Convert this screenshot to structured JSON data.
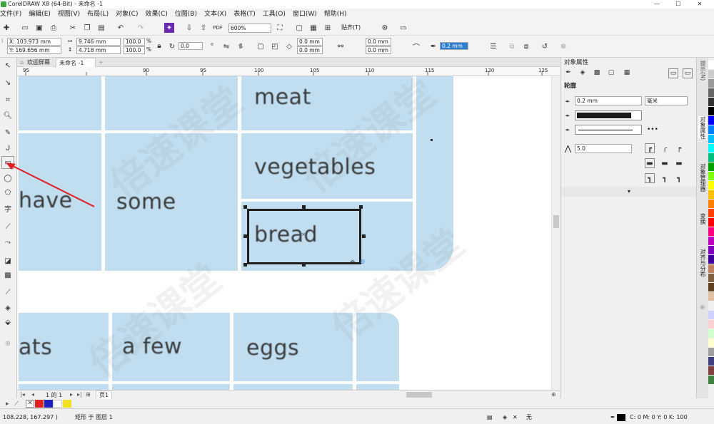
{
  "window": {
    "title": "CorelDRAW X8 (64-Bit) - 未命名 -1",
    "controls": [
      "—",
      "☐",
      "✕"
    ]
  },
  "menu": [
    "文件(F)",
    "编辑(E)",
    "视图(V)",
    "布局(L)",
    "对象(C)",
    "效果(C)",
    "位图(B)",
    "文本(X)",
    "表格(T)",
    "工具(O)",
    "窗口(W)",
    "帮助(H)"
  ],
  "standard": {
    "zoom": "600%",
    "snap": "贴齐(T)"
  },
  "props": {
    "x": "X: 103.973 mm",
    "y": "Y: 169.656 mm",
    "w": "9.746 mm",
    "h": "4.718 mm",
    "sx": "100.0",
    "sy": "100.0",
    "pct": "%",
    "rotation": "0.0",
    "corner1": "0.0 mm",
    "corner2": "0.0 mm",
    "corner3": "0.0 mm",
    "corner4": "0.0 mm",
    "outline": "0.2 mm"
  },
  "tabs": {
    "welcome": "欢迎屏幕",
    "doc": "未命名 -1"
  },
  "ruler": [
    "95",
    "90",
    "95",
    "100",
    "105",
    "110",
    "115",
    "120",
    "125"
  ],
  "canvas": {
    "words": [
      "meat",
      "vegetables",
      "have",
      "some",
      "bread",
      "ats",
      "a few",
      "eggs"
    ],
    "watermark": "倍速课堂"
  },
  "pagebar": {
    "pageinfo": "1 的 1",
    "page": "页1"
  },
  "status": {
    "coords": "108.228, 167.297 )",
    "object": "矩形 于 图层 1",
    "fill": "无",
    "outline": "C: 0 M: 0 Y: 0 K: 100"
  },
  "docker": {
    "title": "对象属性",
    "section": "轮廓",
    "width": "0.2 mm",
    "unit": "毫米",
    "dash": "•••",
    "miter": "5.0",
    "more": "▾"
  },
  "vtabs": [
    "提示(N)",
    "对象属性",
    "对象管理器",
    "变换",
    "对齐与分布"
  ],
  "colors": {
    "accent": "#2f7fd5",
    "cell": "#c0def0",
    "arrow": "#e02020",
    "palette": [
      "#ffffff",
      "#000000",
      "#e02020",
      "#2020c0",
      "#ffffff",
      "#f0e020"
    ],
    "rightpal": [
      "#ffffff",
      "#cccccc",
      "#999999",
      "#666666",
      "#333333",
      "#000000",
      "#0000ff",
      "#0080ff",
      "#00c0ff",
      "#00ffff",
      "#00c080",
      "#00a000",
      "#80ff00",
      "#ffff00",
      "#ffc000",
      "#ff8000",
      "#ff4000",
      "#ff0000",
      "#ff0080",
      "#c000c0",
      "#8000c0",
      "#4000a0",
      "#c08060",
      "#806040",
      "#604020",
      "#e0c0a0",
      "#f0f0f0",
      "#d0d0ff",
      "#ffd0d0",
      "#d0ffd0",
      "#ffffd0",
      "#a0a0a0",
      "#404080",
      "#804040",
      "#408040"
    ]
  }
}
